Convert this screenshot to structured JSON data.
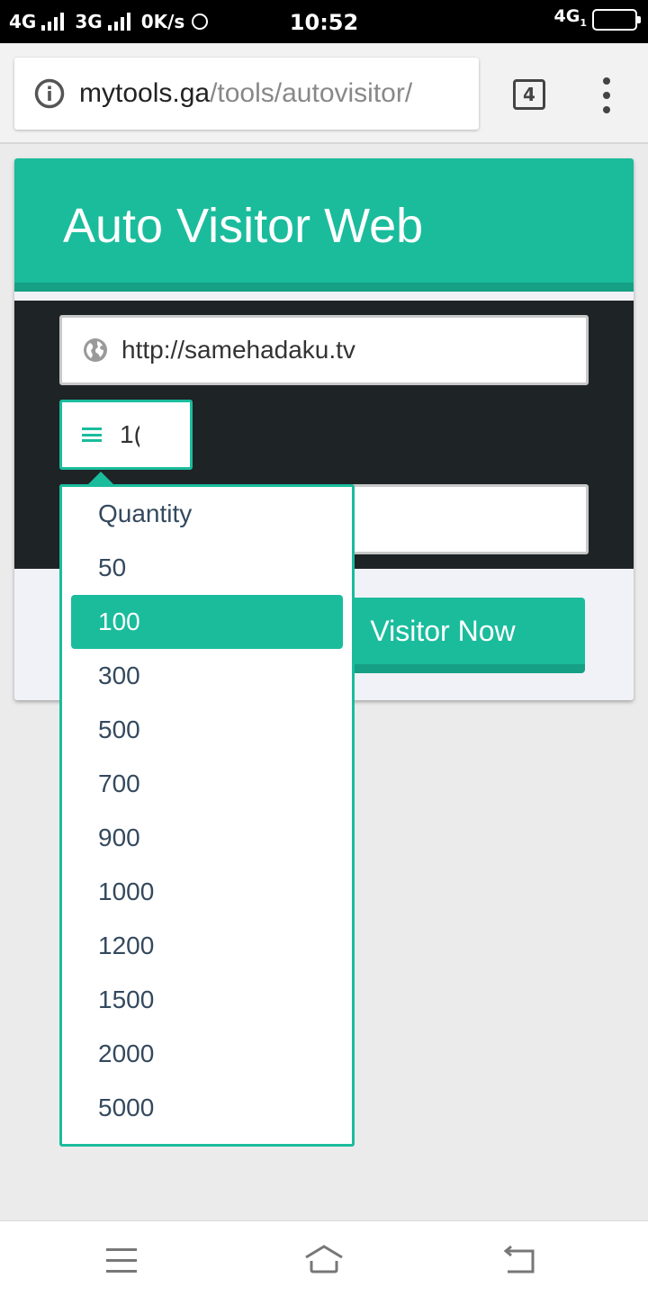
{
  "status_bar": {
    "left": [
      "4G",
      "3G",
      "0K/s"
    ],
    "time": "10:52",
    "right_network": "4G",
    "right_network_sub": "1"
  },
  "browser": {
    "url_host": "mytools.ga",
    "url_path": "/tools/autovisitor/",
    "tab_count": "4"
  },
  "page": {
    "title": "Auto Visitor Web",
    "url_input_value": "http://samehadaku.tv",
    "quantity_selected_visible": "1(",
    "submit_label_visible": "Visitor Now"
  },
  "dropdown": {
    "options": [
      "Quantity",
      "50",
      "100",
      "300",
      "500",
      "700",
      "900",
      "1000",
      "1200",
      "1500",
      "2000",
      "5000"
    ],
    "selected": "100"
  },
  "colors": {
    "accent": "#1abc9c",
    "accent_dark": "#16a085",
    "dark_panel": "#1e2326"
  },
  "icons": {
    "url_bar": "info-icon",
    "url_input": "globe-icon",
    "quantity": "lines-icon",
    "nav": [
      "menu-icon",
      "home-icon",
      "back-icon"
    ]
  }
}
